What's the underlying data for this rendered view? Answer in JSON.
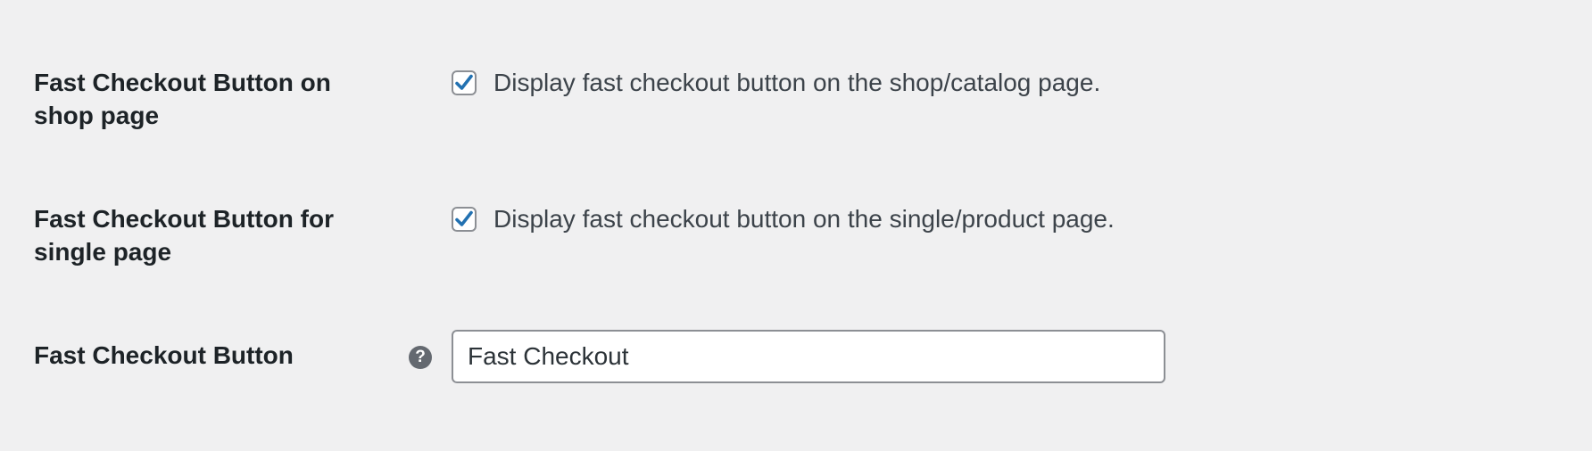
{
  "settings": {
    "shop_page": {
      "label_line1": "Fast Checkout Button on",
      "label_line2": "shop page",
      "checked": true,
      "description": "Display fast checkout button on the shop/catalog page."
    },
    "single_page": {
      "label_line1": "Fast Checkout Button for",
      "label_line2": "single page",
      "checked": true,
      "description": "Display fast checkout button on the single/product page."
    },
    "button_text": {
      "label": "Fast Checkout Button",
      "help_icon": "question-mark-icon",
      "help_glyph": "?",
      "value": "Fast Checkout"
    }
  },
  "colors": {
    "background": "#f0f0f1",
    "checkmark": "#2271b1",
    "border": "#8c8f94",
    "help_icon_bg": "#646970"
  }
}
